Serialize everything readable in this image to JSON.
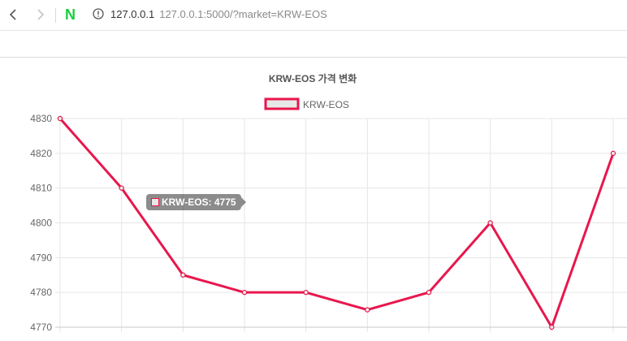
{
  "browser": {
    "back_icon": "chevron-left-icon",
    "forward_icon": "chevron-right-icon",
    "logo_text": "N",
    "logo_color": "#19ce3c",
    "info_icon": "info-circle-icon",
    "address_host": "127.0.0.1",
    "address_full": "127.0.0.1:5000/?market=KRW-EOS"
  },
  "colors": {
    "line": "#e8174d",
    "legend_fill": "#e8e8e8",
    "grid": "#e6e6e6"
  },
  "tooltip": {
    "text": "KRW-EOS: 4775",
    "swatch_color": "#e8e8e8",
    "swatch_border": "#e8174d"
  },
  "chart_data": {
    "type": "line",
    "title": "KRW-EOS 가격 변화",
    "legend": "top-center",
    "grid": true,
    "ylim": [
      4770,
      4830
    ],
    "yticks": [
      4830,
      4820,
      4810,
      4800,
      4790,
      4780,
      4770
    ],
    "series": [
      {
        "name": "KRW-EOS",
        "values": [
          4830,
          4810,
          4785,
          4780,
          4780,
          4775,
          4780,
          4800,
          4770,
          4820
        ]
      }
    ]
  }
}
